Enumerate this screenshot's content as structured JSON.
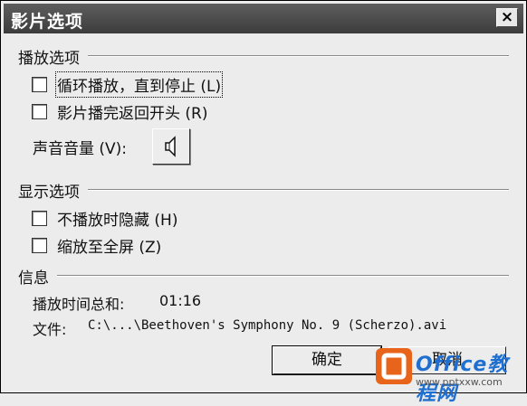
{
  "window": {
    "title": "影片选项",
    "close_label": "×"
  },
  "playback": {
    "heading": "播放选项",
    "loop_label": "循环播放，直到停止 (L)",
    "rewind_label": "影片播完返回开头 (R)",
    "volume_label": "声音音量 (V):"
  },
  "display": {
    "heading": "显示选项",
    "hide_label": "不播放时隐藏 (H)",
    "fullscreen_label": "缩放至全屏 (Z)"
  },
  "info": {
    "heading": "信息",
    "total_time_label": "播放时间总和:",
    "total_time_value": "01:16",
    "file_label": "文件:",
    "file_value": "C:\\...\\Beethoven's Symphony No. 9 (Scherzo).avi"
  },
  "buttons": {
    "ok_label": "确定",
    "cancel_label": "取消"
  },
  "watermark": {
    "brand": "Office教程网",
    "url": "www.pptxxw.com"
  }
}
